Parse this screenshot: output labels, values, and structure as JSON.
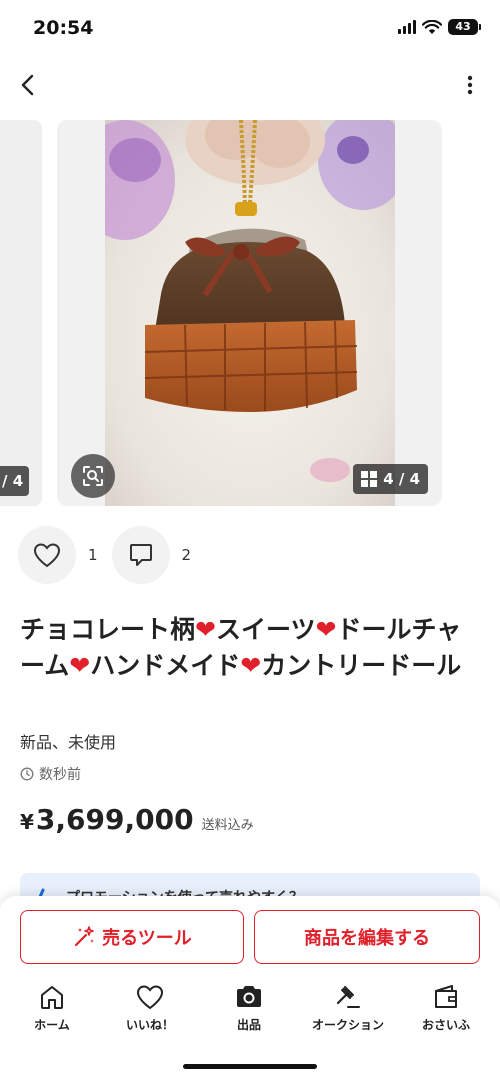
{
  "status_bar": {
    "time": "20:54",
    "battery": "43"
  },
  "product": {
    "image_counter": "4 / 4",
    "prev_counter": "/ 4",
    "likes": "1",
    "comments": "2",
    "title_parts": [
      "チョコレート柄",
      "スイーツ",
      "ドールチャーム",
      "ハンドメイド",
      "カントリードール"
    ],
    "condition": "新品、未使用",
    "posted": "数秒前",
    "price_symbol": "¥",
    "price": "3,699,000",
    "shipping": "送料込み"
  },
  "promo": {
    "text": "プロモーションを使って売れやすく？"
  },
  "cta": {
    "sell_tool": "売るツール",
    "edit": "商品を編集する"
  },
  "tabs": [
    {
      "label": "ホーム",
      "icon": "home-icon"
    },
    {
      "label": "いいね！",
      "icon": "heart-icon"
    },
    {
      "label": "出品",
      "icon": "camera-icon"
    },
    {
      "label": "オークション",
      "icon": "gavel-icon"
    },
    {
      "label": "おさいふ",
      "icon": "wallet-icon"
    }
  ],
  "colors": {
    "accent": "#e0202a",
    "text": "#222222",
    "banner": "#e8f0fb"
  }
}
